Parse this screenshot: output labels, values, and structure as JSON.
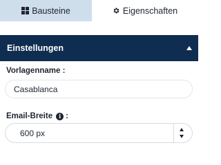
{
  "tabs": {
    "bausteine": {
      "label": "Bausteine",
      "icon": "grid-icon",
      "active": true
    },
    "eigenschaften": {
      "label": "Eigenschaften",
      "icon": "gear-icon"
    }
  },
  "panel": {
    "title": "Einstellungen",
    "collapse_icon": "caret-up-icon"
  },
  "fields": {
    "template_name": {
      "label": "Vorlagenname :",
      "value": "Casablanca"
    },
    "email_width": {
      "label_text": "Email-Breite",
      "label_suffix": ":",
      "info_glyph": "i",
      "value": "600 px"
    }
  },
  "colors": {
    "active_tab_bg": "#cfdeeb",
    "header_bg": "#0f2d50",
    "text": "#1f2530"
  }
}
